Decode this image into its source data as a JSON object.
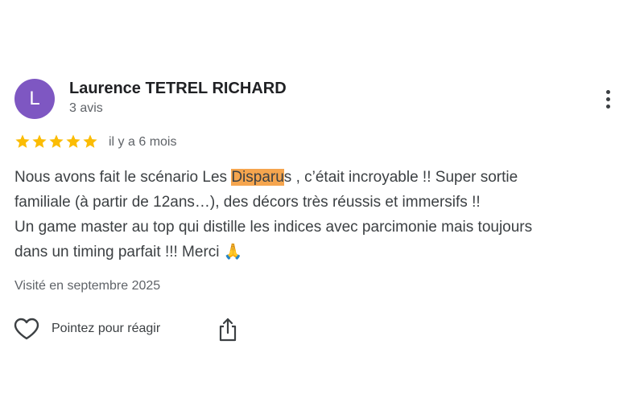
{
  "review": {
    "author": {
      "initial": "L",
      "name": "Laurence TETREL RICHARD",
      "review_count": "3 avis",
      "avatar_color": "#7e57c2"
    },
    "rating": {
      "stars": 5,
      "max": 5,
      "star_color": "#fbbc04"
    },
    "time_ago": "il y a 6 mois",
    "text": {
      "line1_before": "Nous avons fait le scénario Les ",
      "line1_highlight": "Disparu",
      "line1_after": "s , c’était incroyable !! Super sortie",
      "line2": "familiale (à partir de 12ans…), des décors très réussis et immersifs !!",
      "line3": "Un game master au top qui distille les indices avec parcimonie mais toujours",
      "line4": "dans un timing parfait !!! Merci 🙏",
      "highlight_color": "#f5a54e"
    },
    "visited": "Visité en septembre 2025",
    "actions": {
      "react_label": "Pointez pour réagir",
      "react_icon": "heart-icon",
      "share_icon": "share-icon",
      "more_icon": "more-vert-icon"
    }
  }
}
